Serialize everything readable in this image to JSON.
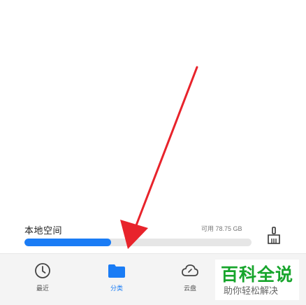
{
  "storage": {
    "label": "本地空间",
    "available_text": "可用 78.75 GB",
    "used_fraction": 0.38,
    "bar_color": "#1a7cf5",
    "track_color": "#e6e6e6"
  },
  "clean_button": {
    "icon": "broom-icon"
  },
  "tabs": [
    {
      "label": "最近",
      "icon": "clock-icon",
      "active": false
    },
    {
      "label": "分类",
      "icon": "folder-icon",
      "active": true
    },
    {
      "label": "云盘",
      "icon": "cloud-icon",
      "active": false
    }
  ],
  "accent_color": "#1a7cf5",
  "annotation": {
    "arrow_color": "#e8232b"
  },
  "watermark": {
    "logo_text": "百科全说",
    "sub_text": "助你轻松解决",
    "color": "#17a52c"
  }
}
